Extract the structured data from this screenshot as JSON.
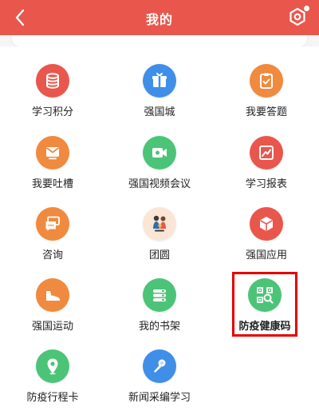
{
  "header": {
    "title": "我的",
    "background": "#e9564c"
  },
  "grid": {
    "items": [
      {
        "label": "学习积分",
        "icon": "database-icon",
        "color": "#e9564c"
      },
      {
        "label": "强国城",
        "icon": "gift-box-icon",
        "color": "#3f8fe8"
      },
      {
        "label": "我要答题",
        "icon": "clipboard-icon",
        "color": "#f08a3e"
      },
      {
        "label": "我要吐槽",
        "icon": "mail-icon",
        "color": "#f08a3e"
      },
      {
        "label": "强国视频会议",
        "icon": "video-camera-icon",
        "color": "#4cc478"
      },
      {
        "label": "学习报表",
        "icon": "chart-icon",
        "color": "#e9564c"
      },
      {
        "label": "咨询",
        "icon": "chat-icon",
        "color": "#f08a3e"
      },
      {
        "label": "团圆",
        "icon": "family-icon",
        "color": "#fbe6d6"
      },
      {
        "label": "强国应用",
        "icon": "cube-icon",
        "color": "#e9564c"
      },
      {
        "label": "强国运动",
        "icon": "sneaker-icon",
        "color": "#f08a3e"
      },
      {
        "label": "我的书架",
        "icon": "books-icon",
        "color": "#4cc478"
      },
      {
        "label": "防疫健康码",
        "icon": "qr-scan-icon",
        "color": "#4cc478"
      },
      {
        "label": "防疫行程卡",
        "icon": "location-pin-icon",
        "color": "#4cc478"
      },
      {
        "label": "新闻采编学习",
        "icon": "microphone-icon",
        "color": "#3f8fe8"
      }
    ]
  }
}
